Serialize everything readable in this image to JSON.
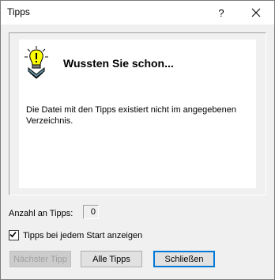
{
  "window": {
    "title": "Tipps",
    "help_glyph": "?",
    "close_glyph": "close-icon"
  },
  "tip": {
    "heading": "Wussten Sie schon...",
    "text": "Die Datei mit den Tipps existiert nicht im angegebenen Verzeichnis.",
    "icon": "lightbulb-icon"
  },
  "count": {
    "label": "Anzahl an Tipps:",
    "value": "0"
  },
  "startup": {
    "label": "Tipps bei jedem Start anzeigen",
    "checked": true
  },
  "buttons": {
    "next": "Nächster Tipp",
    "all": "Alle Tipps",
    "close": "Schließen"
  },
  "colors": {
    "dialog_bg": "#f0f0f0",
    "content_bg": "#ffffff",
    "default_button_border": "#0078d7",
    "bulb_yellow": "#ffff00"
  }
}
